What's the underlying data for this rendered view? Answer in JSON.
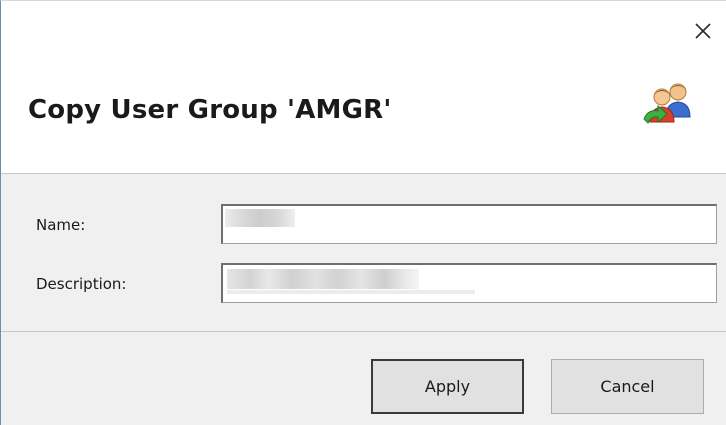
{
  "window": {
    "close_icon": "close-icon"
  },
  "header": {
    "title": "Copy User Group 'AMGR'",
    "icon": "users-copy-icon"
  },
  "form": {
    "name_label": "Name:",
    "name_value": "",
    "description_label": "Description:",
    "description_value": ""
  },
  "buttons": {
    "apply_label": "Apply",
    "cancel_label": "Cancel"
  }
}
